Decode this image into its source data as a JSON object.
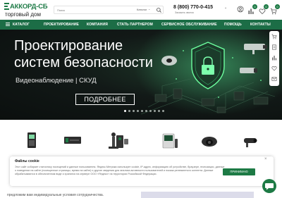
{
  "brand": {
    "name": "АККОРД-СБ",
    "sub": "торговый дом",
    "accent": "#1d7a45",
    "nav_bg": "#1c6d46"
  },
  "search": {
    "placeholder": "Поиск",
    "category_label": "Каталог"
  },
  "contact": {
    "phone": "8 (800) 770-0-415",
    "callback": "Заказать звонок"
  },
  "header_icons": [
    {
      "name": "user-icon"
    },
    {
      "name": "compare-icon",
      "count": "0"
    },
    {
      "name": "favorite-icon",
      "count": "0"
    },
    {
      "name": "cart-icon",
      "count": "0"
    }
  ],
  "nav": {
    "items": [
      "КАТАЛОГ",
      "ПРОЕКТИРОВАНИЕ",
      "КОМПАНИЯ",
      "СТАТЬ ПАРТНЕРОМ",
      "СЕРВИСНОЕ ОБСЛУЖИВАНИЕ",
      "ПОМОЩЬ",
      "КОНТАКТЫ"
    ]
  },
  "hero": {
    "title_line1": "Проектирование",
    "title_line2": "систем безопасности",
    "subtitle": "Видеонаблюдение  |  СКУД",
    "button": "ПОДРОБНЕЕ",
    "slides_total": 10,
    "active_slide": 1
  },
  "side_tools": [
    "cart-icon",
    "document-icon",
    "compare-icon",
    "favorite-icon",
    "mail-icon"
  ],
  "categories": [
    "bio-reader-icon",
    "server-icon",
    "barrier-icon",
    "access-reader-icon",
    "intercom-icon",
    "dome-camera-icon",
    "bullet-camera-icon"
  ],
  "cookie": {
    "title": "Файлы cookie",
    "text": "Этот сайт собирает статистику посещений и данные пользователя. Яндекс.Метрика использует cookie, IP-адрес, информацию об устройстве, браузере, геопозиции, данные о поведении на сайте (посещенные страницы, время на сайте) и другие сведения для анализа активности пользователей и показа релевантного контента. Данные обрабатываются в обезличенном виде и хранятся на сервере ООО «Яндекс» на территории Российской Федерации.",
    "accept": "ПРИНИМАЮ",
    "close": "×"
  },
  "footer_partial": "предложим вам индивидуальные условия сотрудничества."
}
